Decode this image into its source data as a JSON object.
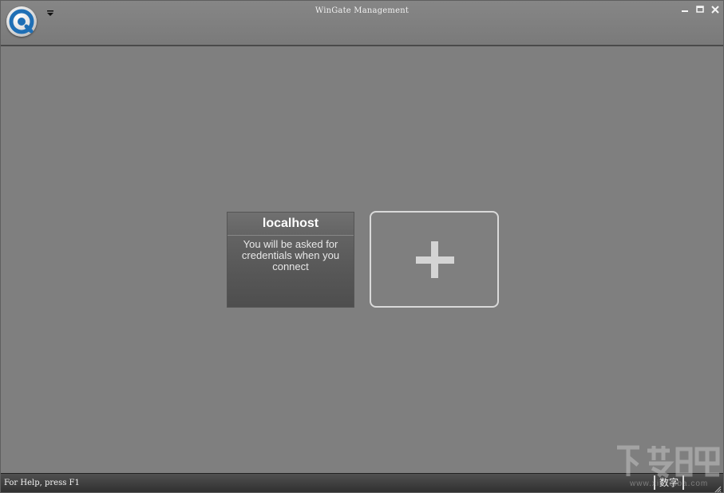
{
  "window": {
    "title": "WinGate Management"
  },
  "icons": {
    "app_logo": "wingate-logo-icon",
    "quick_access": "dropdown-arrow-icon",
    "minimize": "minimize-icon",
    "maximize": "maximize-icon",
    "close": "close-icon",
    "add": "plus-icon"
  },
  "servers": [
    {
      "name": "localhost",
      "description": "You will be asked for credentials when you connect"
    }
  ],
  "status_bar": {
    "help_text": "For Help, press F1",
    "indicator": "数字"
  },
  "watermark": {
    "site": "www.xiazaiba.com"
  },
  "colors": {
    "background": "#7f7f7f",
    "tile": "#5d5d5d",
    "add_border": "#d9d9d9",
    "logo_blue": "#1f6fb5"
  }
}
